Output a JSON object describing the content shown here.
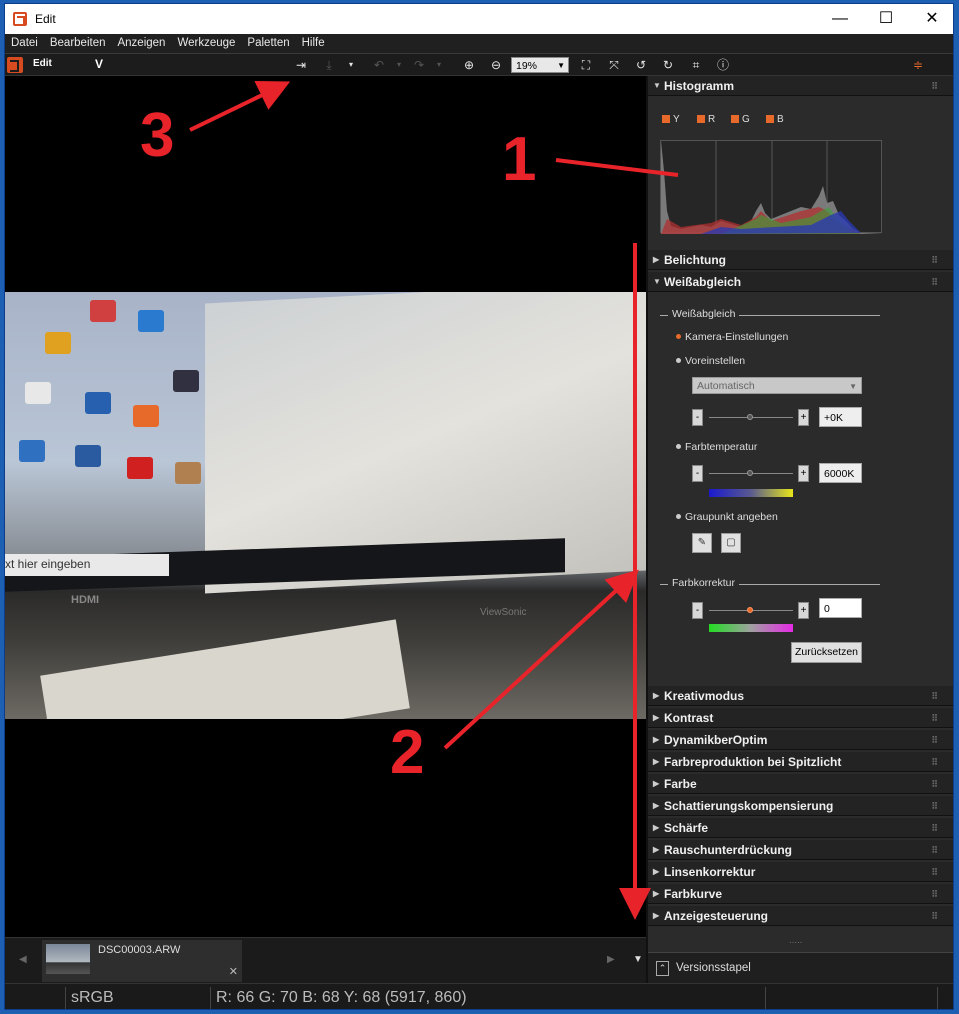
{
  "window": {
    "title": "Edit",
    "minimize": "—",
    "maximize": "☐",
    "close": "✕"
  },
  "menu": [
    "Datei",
    "Bearbeiten",
    "Anzeigen",
    "Werkzeuge",
    "Paletten",
    "Hilfe"
  ],
  "toolbar": {
    "mode_label": "Edit",
    "v_logo": "V",
    "zoom": "19%"
  },
  "annotations": {
    "a1": "1",
    "a2": "2",
    "a3": "3"
  },
  "photo": {
    "search_text": "xt hier eingeben",
    "brand1": "HDMI",
    "brand2": "ViewSonic"
  },
  "filmstrip": {
    "filename": "DSC00003.ARW",
    "close": "✕"
  },
  "status": {
    "colorspace": "sRGB",
    "readout": "R:  66  G:  70  B:  68  Y:  68    (5917,  860)"
  },
  "panel": {
    "histogram": {
      "title": "Histogramm",
      "channels": [
        "Y",
        "R",
        "G",
        "B"
      ]
    },
    "belichtung": "Belichtung",
    "weissabgleich": {
      "title": "Weißabgleich",
      "group_label": "Weißabgleich",
      "opt_camera": "Kamera-Einstellungen",
      "opt_preset": "Voreinstellen",
      "preset_value": "Automatisch",
      "preset_offset": "+0K",
      "opt_temp": "Farbtemperatur",
      "temp_value": "6000K",
      "opt_graypoint": "Graupunkt angeben",
      "color_corr_label": "Farbkorrektur",
      "color_corr_value": "0",
      "reset": "Zurücksetzen"
    },
    "sections": [
      "Kreativmodus",
      "Kontrast",
      "DynamikberOptim",
      "Farbreproduktion bei Spitzlicht",
      "Farbe",
      "Schattierungskompensierung",
      "Schärfe",
      "Rauschunterdrückung",
      "Linsenkorrektur",
      "Farbkurve",
      "Anzeigesteuerung"
    ],
    "version_stack": "Versionsstapel"
  },
  "colors": {
    "accent": "#e86a2a",
    "annotation": "#e8232a"
  }
}
